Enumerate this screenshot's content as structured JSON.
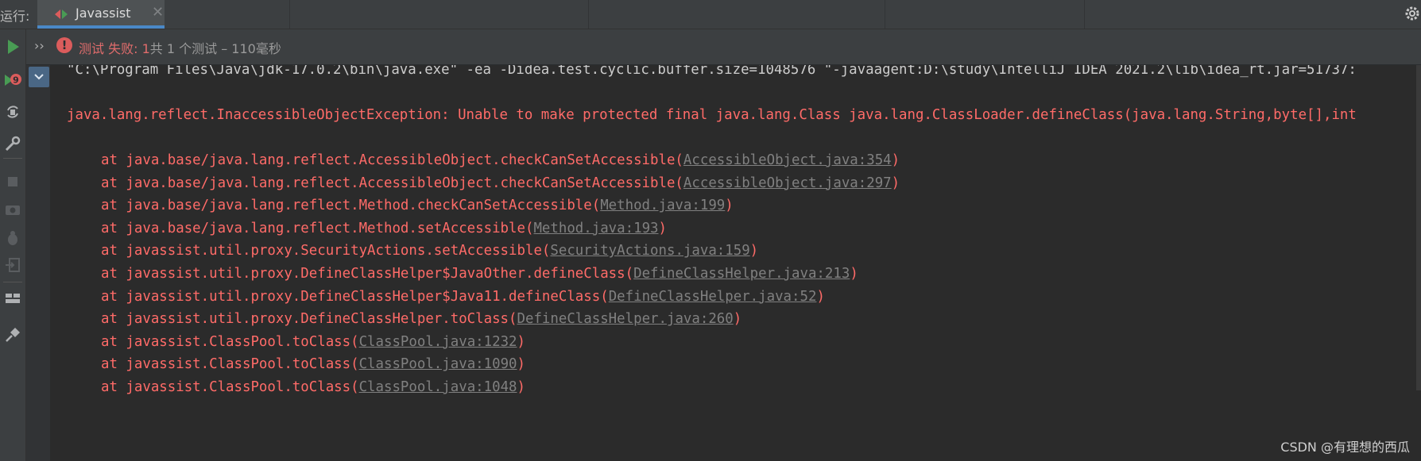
{
  "tabbar": {
    "run_label": "运行:",
    "tab_title": "Javassist",
    "tab_icon": "junit-run-icon",
    "close_icon": "close-icon",
    "settings_icon": "gear-icon"
  },
  "toolstrip": {
    "items": [
      "rerun-icon",
      "rerun-failed-icon",
      "toggle-autotest-icon",
      "settings-wrench-icon",
      "stop-icon",
      "camera-icon",
      "debug-bug-icon",
      "exit-icon",
      "layout-icon",
      "pin-icon"
    ]
  },
  "status": {
    "failed_label": "测试 失败: 1",
    "rest_label": "共 1 个测试 – 110毫秒",
    "chevron": "››"
  },
  "console": {
    "command_line": "\"C:\\Program Files\\Java\\jdk-17.0.2\\bin\\java.exe\" -ea -Didea.test.cyclic.buffer.size=1048576 \"-javaagent:D:\\study\\IntelliJ IDEA 2021.2\\lib\\idea_rt.jar=51737:",
    "exception_line": "java.lang.reflect.InaccessibleObjectException: Unable to make protected final java.lang.Class java.lang.ClassLoader.defineClass(java.lang.String,byte[],int",
    "trace": [
      {
        "prefix": "at java.base/java.lang.reflect.AccessibleObject.checkCanSetAccessible(",
        "link": "AccessibleObject.java:354",
        "suffix": ")"
      },
      {
        "prefix": "at java.base/java.lang.reflect.AccessibleObject.checkCanSetAccessible(",
        "link": "AccessibleObject.java:297",
        "suffix": ")"
      },
      {
        "prefix": "at java.base/java.lang.reflect.Method.checkCanSetAccessible(",
        "link": "Method.java:199",
        "suffix": ")"
      },
      {
        "prefix": "at java.base/java.lang.reflect.Method.setAccessible(",
        "link": "Method.java:193",
        "suffix": ")"
      },
      {
        "prefix": "at javassist.util.proxy.SecurityActions.setAccessible(",
        "link": "SecurityActions.java:159",
        "suffix": ")"
      },
      {
        "prefix": "at javassist.util.proxy.DefineClassHelper$JavaOther.defineClass(",
        "link": "DefineClassHelper.java:213",
        "suffix": ")"
      },
      {
        "prefix": "at javassist.util.proxy.DefineClassHelper$Java11.defineClass(",
        "link": "DefineClassHelper.java:52",
        "suffix": ")"
      },
      {
        "prefix": "at javassist.util.proxy.DefineClassHelper.toClass(",
        "link": "DefineClassHelper.java:260",
        "suffix": ")"
      },
      {
        "prefix": "at javassist.ClassPool.toClass(",
        "link": "ClassPool.java:1232",
        "suffix": ")"
      },
      {
        "prefix": "at javassist.ClassPool.toClass(",
        "link": "ClassPool.java:1090",
        "suffix": ")"
      },
      {
        "prefix": "at javassist.ClassPool.toClass(",
        "link": "ClassPool.java:1048",
        "suffix": ")"
      }
    ]
  },
  "watermark": "CSDN @有理想的西瓜",
  "colors": {
    "error_red": "#ff6b68",
    "link_gray": "#808080",
    "accent_blue": "#4a88c7",
    "run_green": "#499c54"
  }
}
